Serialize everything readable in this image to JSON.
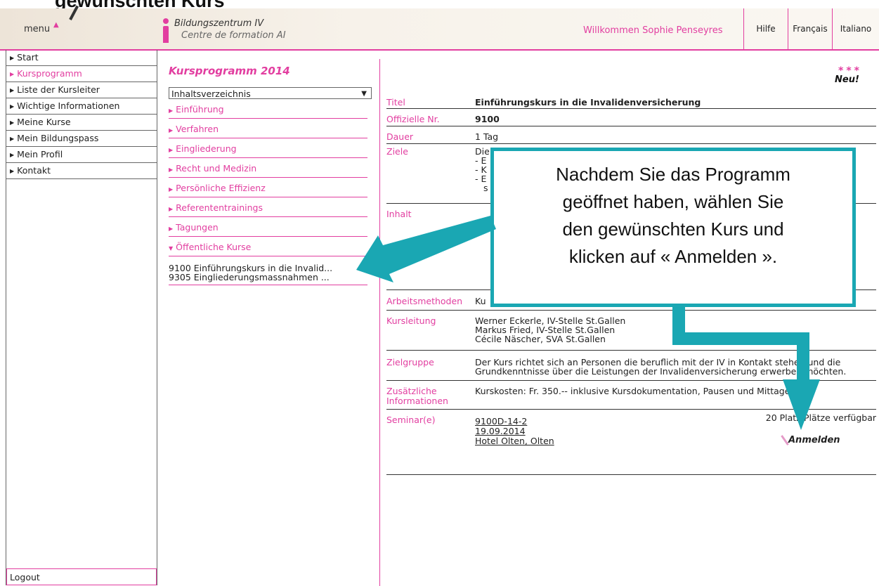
{
  "slide": {
    "title": "gewünschten Kurs"
  },
  "header": {
    "menu_label": "menu",
    "logo_line1": "Bildungszentrum IV",
    "logo_line2": "Centre de formation AI",
    "welcome": "Willkommen Sophie Penseyres",
    "links": [
      "Hilfe",
      "Français",
      "Italiano"
    ]
  },
  "sidebar": {
    "items": [
      {
        "label": "Start"
      },
      {
        "label": "Kursprogramm"
      },
      {
        "label": "Liste der Kursleiter"
      },
      {
        "label": "Wichtige Informationen"
      },
      {
        "label": "Meine Kurse"
      },
      {
        "label": "Mein Bildungspass"
      },
      {
        "label": "Mein Profil"
      },
      {
        "label": "Kontakt"
      }
    ],
    "logout": "Logout"
  },
  "program": {
    "title": "Kursprogramm 2014",
    "select_value": "Inhaltsverzeichnis",
    "categories": [
      {
        "label": "Einführung"
      },
      {
        "label": "Verfahren"
      },
      {
        "label": "Eingliederung"
      },
      {
        "label": "Recht und Medizin"
      },
      {
        "label": "Persönliche Effizienz"
      },
      {
        "label": "Referententrainings"
      },
      {
        "label": "Tagungen"
      },
      {
        "label": "Öffentliche Kurse"
      }
    ],
    "courses": [
      {
        "label": "9100 Einführungskurs in die Invalid..."
      },
      {
        "label": "9305 Eingliederungsmassnahmen ..."
      }
    ]
  },
  "badge": {
    "stars": "***",
    "text": "Neu!"
  },
  "detail": {
    "titel_k": "Titel",
    "titel_v": "Einführungskurs in die Invalidenversicherung",
    "nr_k": "Offizielle Nr.",
    "nr_v": "9100",
    "dauer_k": "Dauer",
    "dauer_v": "1 Tag",
    "ziele_k": "Ziele",
    "ziele_v": [
      "Die",
      "- E",
      "- K",
      "- E",
      "s"
    ],
    "inhalt_k": "Inhalt",
    "methoden_k": "Arbeitsmethoden",
    "methoden_v": "Ku",
    "leitung_k": "Kursleitung",
    "leitung_v": [
      "Werner Eckerle, IV-Stelle St.Gallen",
      "Markus Fried, IV-Stelle St.Gallen",
      "Cécile Näscher, SVA St.Gallen"
    ],
    "gruppe_k": "Zielgruppe",
    "gruppe_v": [
      "Der Kurs richtet sich an Personen die beruflich mit der IV in Kontakt stehen und die",
      "Grundkenntnisse über die Leistungen der Invalidenversicherung erwerben möchten."
    ],
    "zusatz_k1": "Zusätzliche",
    "zusatz_k2": "Informationen",
    "zusatz_v": "Kurskosten: Fr. 350.-- inklusive Kursdokumentation, Pausen und Mittagessen.",
    "seminar_k": "Seminar(e)",
    "seminar_links": [
      "9100D-14-2",
      "19.09.2014",
      "Hotel Olten, Olten"
    ],
    "seats": "20 Platz/Plätze verfügbar",
    "register": "Anmelden"
  },
  "callout": {
    "lines": [
      "Nachdem Sie das Programm",
      "geöffnet haben, wählen Sie",
      "den gewünschten Kurs und",
      "klicken auf « Anmelden »."
    ]
  },
  "colors": {
    "accent": "#e23ea0",
    "callout": "#1aa7b3"
  }
}
